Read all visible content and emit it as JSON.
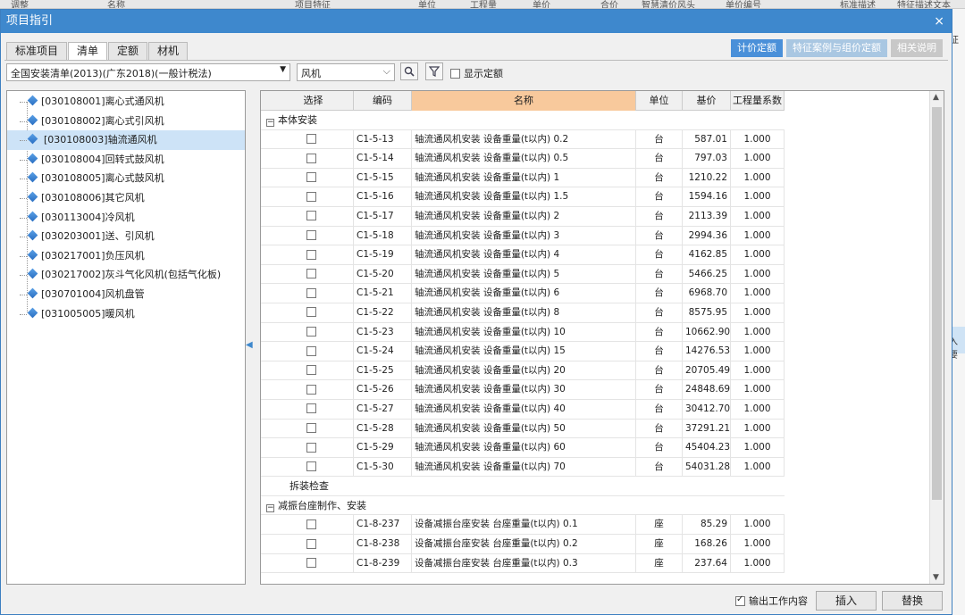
{
  "background": {
    "headers": [
      "调整",
      "名称",
      "项目特征",
      "单位",
      "工程量",
      "单价",
      "合价",
      "智慧清价风头",
      "单价编号",
      "标准描述",
      "特征描述文本"
    ],
    "right_texts": [
      "征",
      "入要"
    ]
  },
  "dialog": {
    "title": "项目指引",
    "close": "×"
  },
  "tabs": [
    {
      "label": "标准项目"
    },
    {
      "label": "清单"
    },
    {
      "label": "定额"
    },
    {
      "label": "材机"
    }
  ],
  "top_buttons": [
    {
      "label": "计价定额"
    },
    {
      "label": "特征案例与组价定额"
    },
    {
      "label": "相关说明"
    }
  ],
  "library": {
    "value": "全国安装清单(2013)(广东2018)(一般计税法)",
    "arrow": "▼"
  },
  "keyword": {
    "value": "风机",
    "arrow": "⌵"
  },
  "show_quota": {
    "label": "显示定额"
  },
  "tree": [
    {
      "label": "[030108001]离心式通风机"
    },
    {
      "label": "[030108002]离心式引风机"
    },
    {
      "label": "[030108003]轴流通风机"
    },
    {
      "label": "[030108004]回转式鼓风机"
    },
    {
      "label": "[030108005]离心式鼓风机"
    },
    {
      "label": "[030108006]其它风机"
    },
    {
      "label": "[030113004]冷风机"
    },
    {
      "label": "[030203001]送、引风机"
    },
    {
      "label": "[030217001]负压风机"
    },
    {
      "label": "[030217002]灰斗气化风机(包括气化板)"
    },
    {
      "label": "[030701004]风机盘管"
    },
    {
      "label": "[031005005]暖风机"
    }
  ],
  "grid": {
    "headers": [
      "选择",
      "编码",
      "名称",
      "单位",
      "基价",
      "工程量系数"
    ],
    "groups": [
      {
        "title": "本体安装",
        "expander": "−",
        "rows": [
          {
            "code": "C1-5-13",
            "name": "轴流通风机安装 设备重量(t以内) 0.2",
            "unit": "台",
            "price": "587.01",
            "coef": "1.000"
          },
          {
            "code": "C1-5-14",
            "name": "轴流通风机安装 设备重量(t以内) 0.5",
            "unit": "台",
            "price": "797.03",
            "coef": "1.000"
          },
          {
            "code": "C1-5-15",
            "name": "轴流通风机安装 设备重量(t以内) 1",
            "unit": "台",
            "price": "1210.22",
            "coef": "1.000"
          },
          {
            "code": "C1-5-16",
            "name": "轴流通风机安装 设备重量(t以内) 1.5",
            "unit": "台",
            "price": "1594.16",
            "coef": "1.000"
          },
          {
            "code": "C1-5-17",
            "name": "轴流通风机安装 设备重量(t以内) 2",
            "unit": "台",
            "price": "2113.39",
            "coef": "1.000"
          },
          {
            "code": "C1-5-18",
            "name": "轴流通风机安装 设备重量(t以内) 3",
            "unit": "台",
            "price": "2994.36",
            "coef": "1.000"
          },
          {
            "code": "C1-5-19",
            "name": "轴流通风机安装 设备重量(t以内) 4",
            "unit": "台",
            "price": "4162.85",
            "coef": "1.000"
          },
          {
            "code": "C1-5-20",
            "name": "轴流通风机安装 设备重量(t以内) 5",
            "unit": "台",
            "price": "5466.25",
            "coef": "1.000"
          },
          {
            "code": "C1-5-21",
            "name": "轴流通风机安装 设备重量(t以内) 6",
            "unit": "台",
            "price": "6968.70",
            "coef": "1.000"
          },
          {
            "code": "C1-5-22",
            "name": "轴流通风机安装 设备重量(t以内) 8",
            "unit": "台",
            "price": "8575.95",
            "coef": "1.000"
          },
          {
            "code": "C1-5-23",
            "name": "轴流通风机安装 设备重量(t以内) 10",
            "unit": "台",
            "price": "10662.90",
            "coef": "1.000"
          },
          {
            "code": "C1-5-24",
            "name": "轴流通风机安装 设备重量(t以内) 15",
            "unit": "台",
            "price": "14276.53",
            "coef": "1.000"
          },
          {
            "code": "C1-5-25",
            "name": "轴流通风机安装 设备重量(t以内) 20",
            "unit": "台",
            "price": "20705.49",
            "coef": "1.000"
          },
          {
            "code": "C1-5-26",
            "name": "轴流通风机安装 设备重量(t以内) 30",
            "unit": "台",
            "price": "24848.69",
            "coef": "1.000"
          },
          {
            "code": "C1-5-27",
            "name": "轴流通风机安装 设备重量(t以内) 40",
            "unit": "台",
            "price": "30412.70",
            "coef": "1.000"
          },
          {
            "code": "C1-5-28",
            "name": "轴流通风机安装 设备重量(t以内) 50",
            "unit": "台",
            "price": "37291.21",
            "coef": "1.000"
          },
          {
            "code": "C1-5-29",
            "name": "轴流通风机安装 设备重量(t以内) 60",
            "unit": "台",
            "price": "45404.23",
            "coef": "1.000"
          },
          {
            "code": "C1-5-30",
            "name": "轴流通风机安装 设备重量(t以内) 70",
            "unit": "台",
            "price": "54031.28",
            "coef": "1.000"
          }
        ]
      },
      {
        "title": "拆装检查",
        "expander": "",
        "rows": []
      },
      {
        "title": "减振台座制作、安装",
        "expander": "−",
        "rows": [
          {
            "code": "C1-8-237",
            "name": "设备减振台座安装 台座重量(t以内) 0.1",
            "unit": "座",
            "price": "85.29",
            "coef": "1.000"
          },
          {
            "code": "C1-8-238",
            "name": "设备减振台座安装 台座重量(t以内) 0.2",
            "unit": "座",
            "price": "168.26",
            "coef": "1.000"
          },
          {
            "code": "C1-8-239",
            "name": "设备减振台座安装 台座重量(t以内) 0.3",
            "unit": "座",
            "price": "237.64",
            "coef": "1.000"
          }
        ]
      }
    ]
  },
  "bottom": {
    "output_work": "输出工作内容",
    "insert": "插入",
    "replace": "替换"
  }
}
